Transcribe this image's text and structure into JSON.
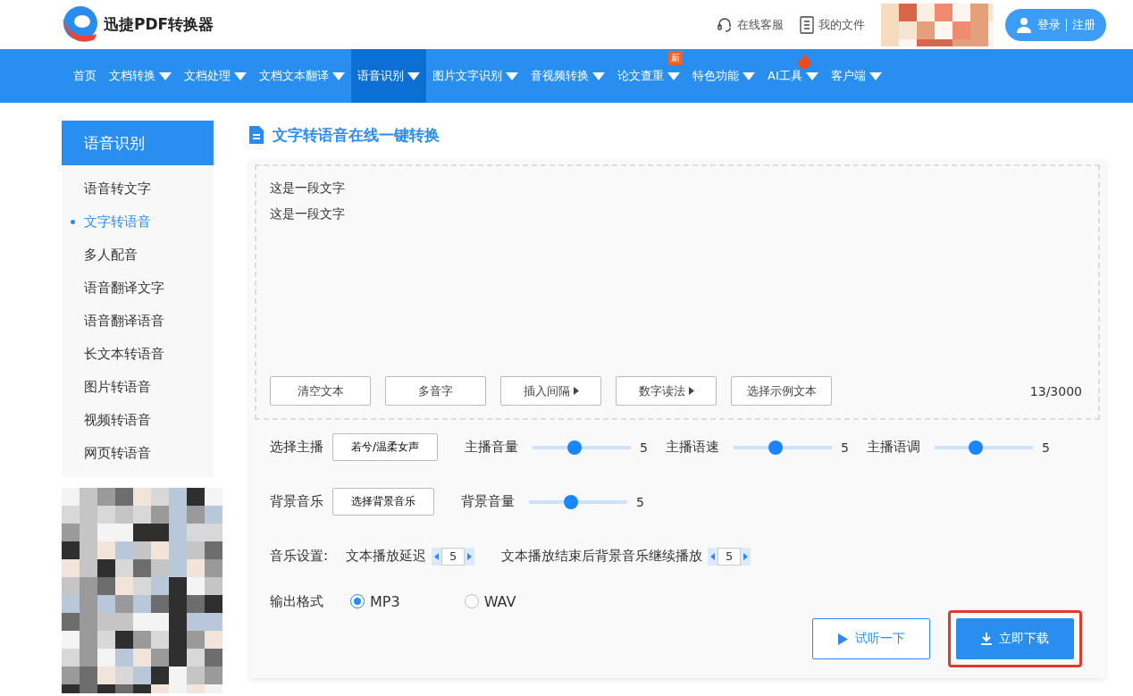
{
  "header": {
    "brand": "迅捷PDF转换器",
    "links": [
      {
        "kind": "headset",
        "label": "在线客服"
      },
      {
        "kind": "file",
        "label": "我的文件"
      }
    ],
    "login": "登录",
    "register": "注册"
  },
  "nav": [
    {
      "label": "首页",
      "caret": false,
      "selected": false,
      "hot": false
    },
    {
      "label": "文档转换",
      "caret": true,
      "selected": false,
      "hot": false
    },
    {
      "label": "文档处理",
      "caret": true,
      "selected": false,
      "hot": false
    },
    {
      "label": "文档文本翻译",
      "caret": true,
      "selected": false,
      "hot": false
    },
    {
      "label": "语音识别",
      "caret": true,
      "selected": true,
      "hot": false
    },
    {
      "label": "图片文字识别",
      "caret": true,
      "selected": false,
      "hot": false
    },
    {
      "label": "音视频转换",
      "caret": true,
      "selected": false,
      "hot": false
    },
    {
      "label": "论文查重",
      "caret": true,
      "selected": false,
      "hot": false,
      "badge": "新"
    },
    {
      "label": "特色功能",
      "caret": true,
      "selected": false,
      "hot": false
    },
    {
      "label": "AI工具",
      "caret": true,
      "selected": false,
      "hot": true
    },
    {
      "label": "客户端",
      "caret": true,
      "selected": false,
      "hot": false
    }
  ],
  "sidebar": {
    "title": "语音识别",
    "items": [
      {
        "label": "语音转文字",
        "selected": false
      },
      {
        "label": "文字转语音",
        "selected": true
      },
      {
        "label": "多人配音",
        "selected": false
      },
      {
        "label": "语音翻译文字",
        "selected": false
      },
      {
        "label": "语音翻译语音",
        "selected": false
      },
      {
        "label": "长文本转语音",
        "selected": false
      },
      {
        "label": "图片转语音",
        "selected": false
      },
      {
        "label": "视频转语音",
        "selected": false
      },
      {
        "label": "网页转语音",
        "selected": false
      }
    ]
  },
  "main": {
    "title": "文字转语音在线一键转换",
    "text_lines": [
      "这是一段文字",
      "这是一段文字"
    ],
    "tools": [
      {
        "label": "清空文本",
        "arrow": false
      },
      {
        "label": "多音字",
        "arrow": false
      },
      {
        "label": "插入间隔",
        "arrow": true
      },
      {
        "label": "数字读法",
        "arrow": true
      },
      {
        "label": "选择示例文本",
        "arrow": false
      }
    ],
    "counter": "13/3000",
    "anchor": {
      "label": "选择主播",
      "value": "若兮/温柔女声"
    },
    "sliders": [
      {
        "label": "主播音量",
        "level": 0.41,
        "reading": "5"
      },
      {
        "label": "主播语速",
        "level": 0.41,
        "reading": "5"
      },
      {
        "label": "主播语调",
        "level": 0.41,
        "reading": "5"
      }
    ],
    "music": {
      "label": "背景音乐",
      "value": "选择背景音乐"
    },
    "music_slider": {
      "label": "背景音量",
      "level": 0.41,
      "reading": "5"
    },
    "settings": {
      "label": "音乐设置:",
      "steppers": [
        {
          "label": "文本播放延迟",
          "value": "5"
        },
        {
          "label": "文本播放结束后背景音乐继续播放",
          "value": "5"
        }
      ]
    },
    "format": {
      "label": "输出格式",
      "options": [
        {
          "label": "MP3",
          "selected": true
        },
        {
          "label": "WAV",
          "selected": false
        }
      ]
    },
    "preview": "试听一下",
    "download": "立即下载",
    "download_highlighted": true
  }
}
